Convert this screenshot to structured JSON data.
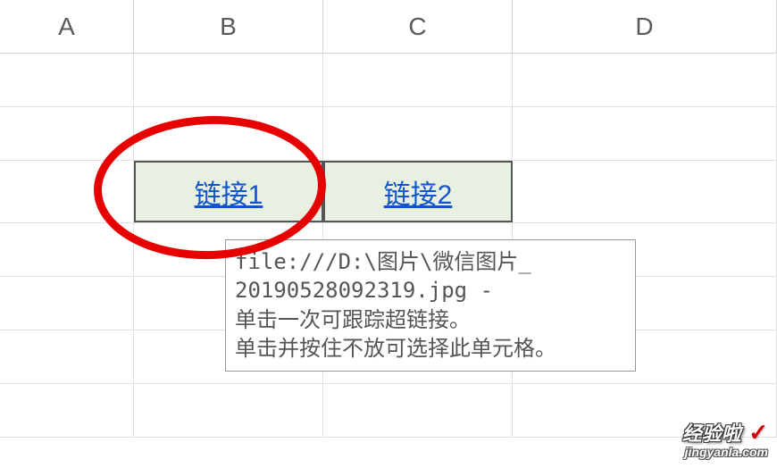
{
  "columns": {
    "a": "A",
    "b": "B",
    "c": "C",
    "d": "D"
  },
  "cells": {
    "b3": "链接1",
    "c3": "链接2"
  },
  "tooltip": {
    "line1": "file:///D:\\图片\\微信图片_",
    "line2": "20190528092319.jpg -",
    "line3": "单击一次可跟踪超链接。",
    "line4": "单击并按住不放可选择此单元格。"
  },
  "watermark": {
    "main": "经验啦",
    "check": "✓",
    "sub": "jingyanla.com"
  }
}
